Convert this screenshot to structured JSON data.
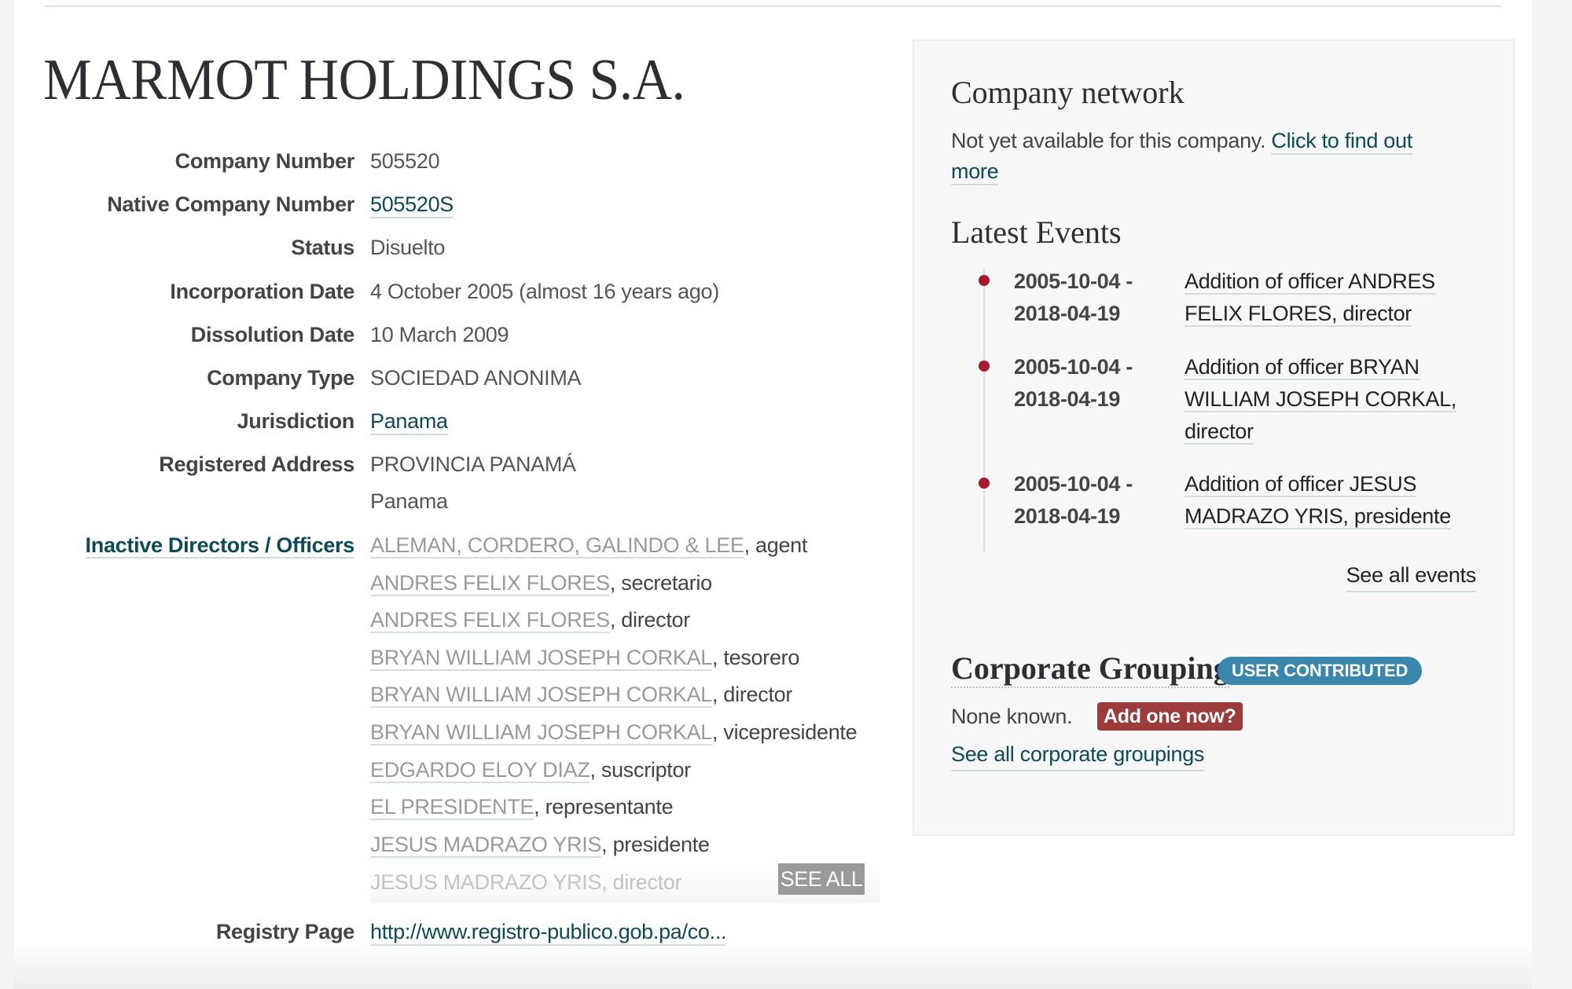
{
  "company": {
    "name": "MARMOT HOLDINGS S.A."
  },
  "details": {
    "company_number": {
      "label": "Company Number",
      "value": "505520"
    },
    "native_company_number": {
      "label": "Native Company Number",
      "value": "505520S"
    },
    "status": {
      "label": "Status",
      "value": "Disuelto"
    },
    "incorporation_date": {
      "label": "Incorporation Date",
      "value": "4 October 2005 (almost 16 years ago)"
    },
    "dissolution_date": {
      "label": "Dissolution Date",
      "value": "10 March 2009"
    },
    "company_type": {
      "label": "Company Type",
      "value": "SOCIEDAD ANONIMA"
    },
    "jurisdiction": {
      "label": "Jurisdiction",
      "value": "Panama"
    },
    "registered_address": {
      "label": "Registered Address",
      "line1": "PROVINCIA PANAMÁ",
      "line2": "Panama"
    },
    "registry_page": {
      "label": "Registry Page",
      "value": "http://www.registro-publico.gob.pa/co..."
    }
  },
  "officers": {
    "label": "Inactive Directors / Officers",
    "items": [
      {
        "name": "ALEMAN, CORDERO, GALINDO & LEE",
        "role": ", agent"
      },
      {
        "name": "ANDRES FELIX FLORES",
        "role": ", secretario"
      },
      {
        "name": "ANDRES FELIX FLORES",
        "role": ", director"
      },
      {
        "name": "BRYAN WILLIAM JOSEPH CORKAL",
        "role": ", tesorero"
      },
      {
        "name": "BRYAN WILLIAM JOSEPH CORKAL",
        "role": ", director"
      },
      {
        "name": "BRYAN WILLIAM JOSEPH CORKAL",
        "role": ", vicepresidente"
      },
      {
        "name": "EDGARDO ELOY DIAZ",
        "role": ", suscriptor"
      },
      {
        "name": "EL PRESIDENTE",
        "role": ", representante"
      },
      {
        "name": "JESUS MADRAZO YRIS",
        "role": ", presidente"
      }
    ],
    "faded_item": "JESUS MADRAZO YRIS, director",
    "see_all_label": "SEE ALL"
  },
  "side": {
    "network": {
      "heading": "Company network",
      "text": "Not yet available for this company.",
      "link_part1": "Click to find out",
      "link_part2": "more"
    },
    "events": {
      "heading": "Latest Events",
      "items": [
        {
          "date_from": "2005-10-04 -",
          "date_to": "2018-04-19",
          "lines": [
            "Addition of officer ANDRES",
            "FELIX FLORES, director"
          ]
        },
        {
          "date_from": "2005-10-04 -",
          "date_to": "2018-04-19",
          "lines": [
            "Addition of officer BRYAN",
            "WILLIAM JOSEPH CORKAL,",
            "director"
          ]
        },
        {
          "date_from": "2005-10-04 -",
          "date_to": "2018-04-19",
          "lines": [
            "Addition of officer JESUS",
            "MADRAZO YRIS, presidente"
          ]
        }
      ],
      "see_all_label": "See all events",
      "dot_color": "#a8192e"
    },
    "grouping": {
      "heading": "Corporate Grouping",
      "badge": "USER CONTRIBUTED",
      "badge_color": "#3a87ad",
      "none_text": "None known.",
      "add_button": "Add one now?",
      "add_button_color": "#9d3a3a",
      "see_all_label": "See all corporate groupings"
    }
  },
  "colors": {
    "link": "#0b4b55",
    "heading": "#2f2f33"
  }
}
